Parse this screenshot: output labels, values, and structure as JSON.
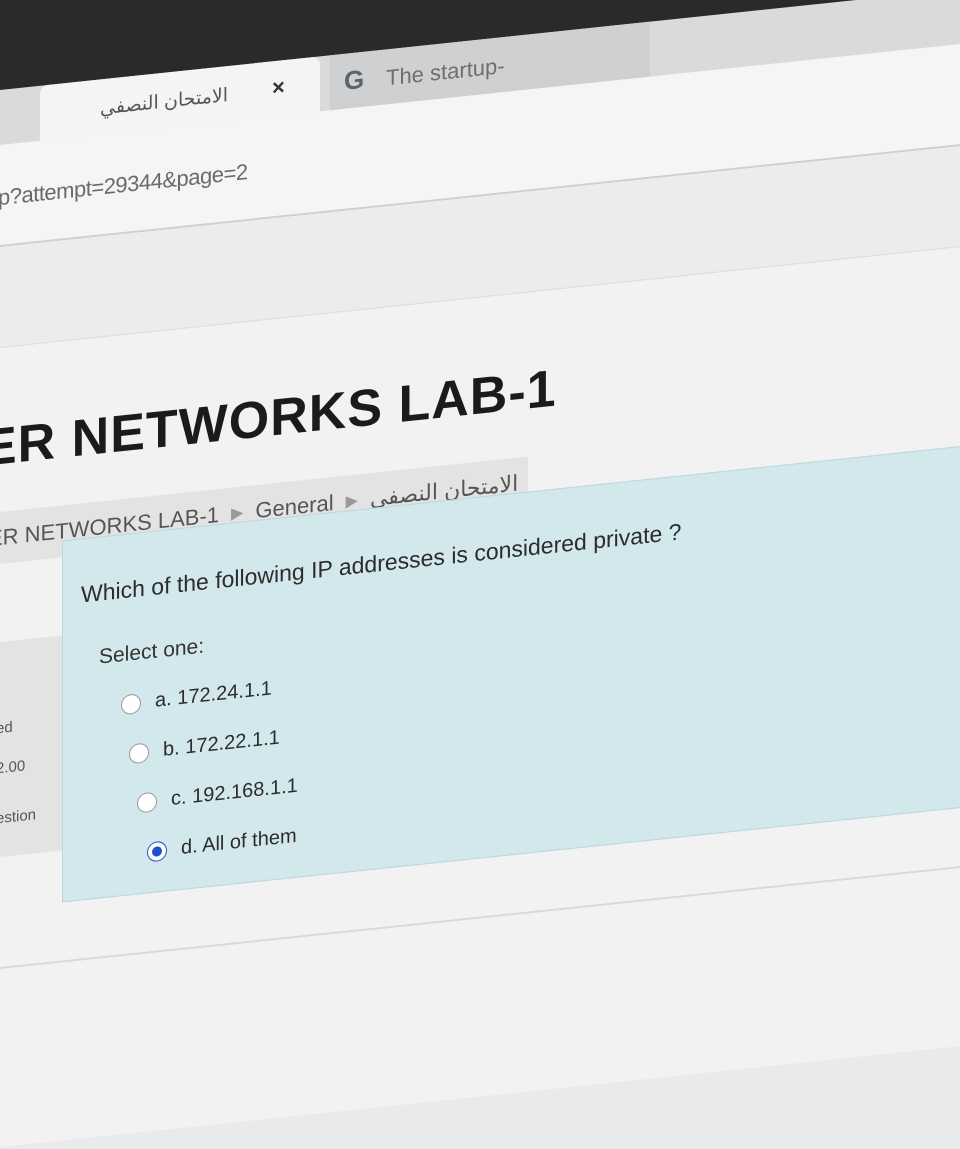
{
  "browser": {
    "tabs": [
      {
        "label": "الامتحان النصفي",
        "close_glyph": "×",
        "active": true
      },
      {
        "label": "The startup-",
        "icon": "google-g-icon",
        "active": false
      }
    ],
    "url": "p?attempt=29344&page=2"
  },
  "course": {
    "title": "ER NETWORKS LAB-1"
  },
  "breadcrumb": [
    "ER NETWORKS LAB-1",
    "General",
    "الامتحان النصفي"
  ],
  "question_info": {
    "status_fragment": "ed",
    "marks_fragment": "2.00",
    "flag_fragment": "estion"
  },
  "question": {
    "text": "Which of the following  IP addresses is considered private ?",
    "prompt": "Select one:",
    "options": [
      {
        "label": "a. 172.24.1.1",
        "selected": false
      },
      {
        "label": "b. 172.22.1.1",
        "selected": false
      },
      {
        "label": "c. 192.168.1.1",
        "selected": false
      },
      {
        "label": "d. All of them",
        "selected": true
      }
    ]
  },
  "colors": {
    "question_panel": "#d3e8ec",
    "radio_selected": "#1e4fcf"
  }
}
